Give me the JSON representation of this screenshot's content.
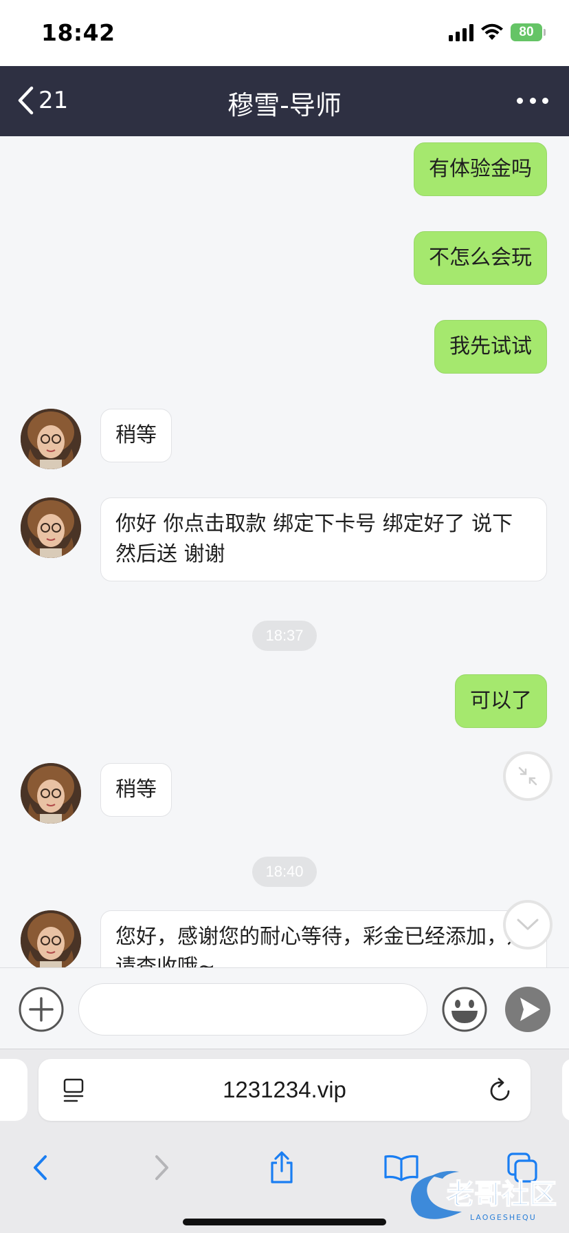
{
  "status_bar": {
    "time": "18:42",
    "battery": "80"
  },
  "header": {
    "back_count": "21",
    "title": "穆雪-导师"
  },
  "chat": {
    "messages": [
      {
        "side": "out",
        "text": "有体验金吗"
      },
      {
        "side": "out",
        "text": "不怎么会玩"
      },
      {
        "side": "out",
        "text": "我先试试"
      },
      {
        "side": "in",
        "text": "稍等"
      },
      {
        "side": "in",
        "text": "你好 你点击取款 绑定下卡号 绑定好了 说下 然后送 谢谢"
      },
      {
        "side": "out",
        "text": "可以了"
      },
      {
        "side": "in",
        "text": "稍等"
      },
      {
        "side": "in",
        "text": "您好，感谢您的耐心等待，彩金已经添加，还请查收哦~"
      }
    ],
    "timestamps": [
      "18:37",
      "18:40"
    ]
  },
  "input_bar": {
    "value": "",
    "placeholder": ""
  },
  "safari": {
    "url": "1231234.vip"
  },
  "watermark": {
    "main": "老哥社区",
    "sub": "LAOGESHEQU"
  },
  "colors": {
    "nav_bg": "#2e3042",
    "bubble_out": "#a5e86e",
    "bubble_in": "#ffffff",
    "accent_blue": "#1a7ef2"
  },
  "icons": [
    "back-chevron-icon",
    "more-dots-icon",
    "collapse-arrows-icon",
    "chevron-down-icon",
    "plus-circle-icon",
    "smiley-icon",
    "send-arrow-icon",
    "reader-icon",
    "reload-icon",
    "back-icon",
    "forward-icon",
    "share-icon",
    "bookmarks-icon",
    "tabs-icon"
  ]
}
